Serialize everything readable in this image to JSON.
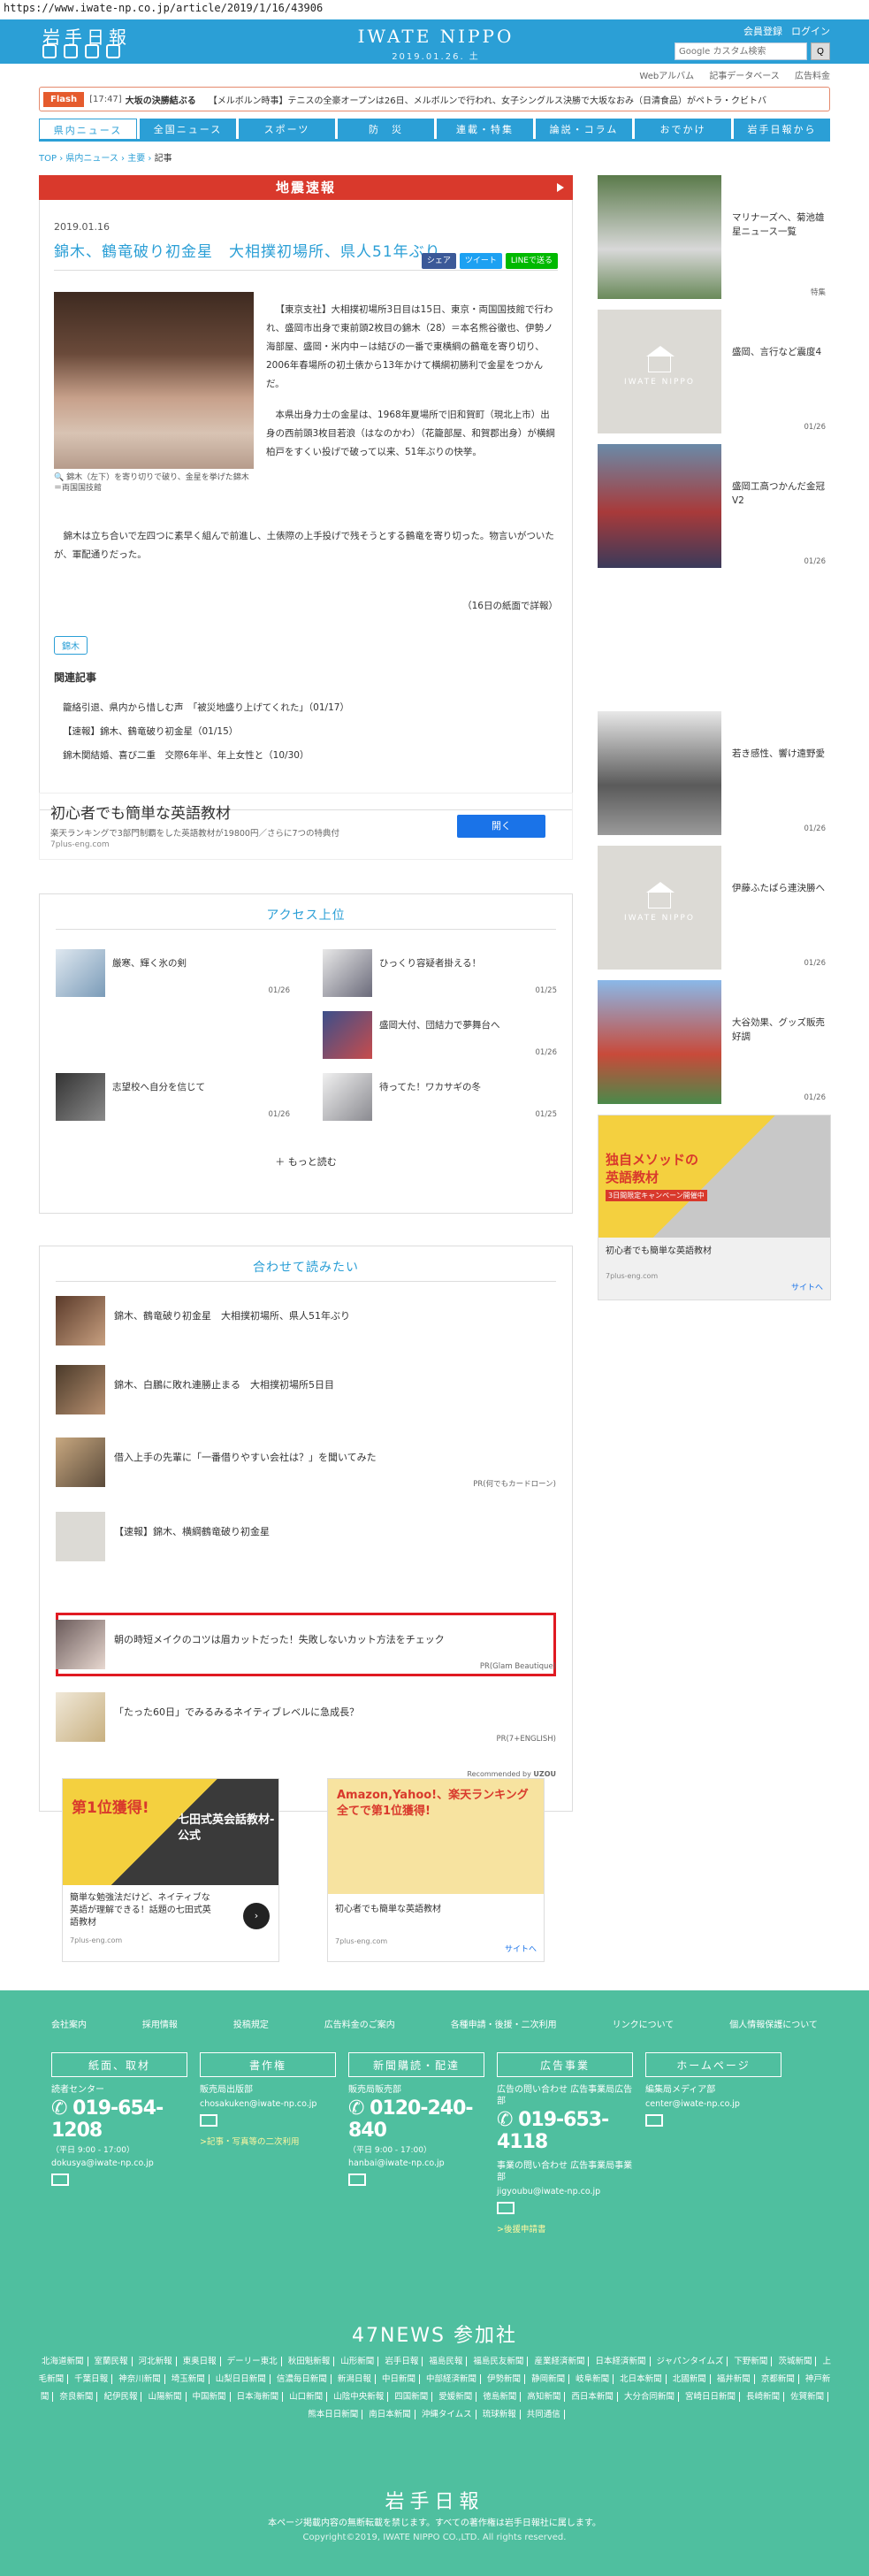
{
  "url": "https://www.iwate-np.co.jp/article/2019/1/16/43906",
  "header": {
    "logo": "岩手日報",
    "brand": "IWATE NIPPO",
    "date": "2019.01.26. 土",
    "member": "会員登録",
    "login": "ログイン",
    "search_placeholder": "Google カスタム検索",
    "search_btn": "Q"
  },
  "sublinks": [
    "Webアルバム",
    "記事データベース",
    "広告料金"
  ],
  "flash": {
    "tag": "Flash",
    "time": "[17:47]",
    "headline": "大坂の決勝結ぶる",
    "text": "【メルボルン時事】テニスの全豪オープンは26日、メルボルンで行われ、女子シングルス決勝で大坂なおみ（日清食品）がペトラ・クビトバ"
  },
  "nav": [
    "県内ニュース",
    "全国ニュース",
    "スポーツ",
    "防　災",
    "連載・特集",
    "論説・コラム",
    "おでかけ",
    "岩手日報から"
  ],
  "breadcrumb": [
    "TOP",
    "県内ニュース",
    "主要",
    "記事"
  ],
  "quake": "地震速報",
  "article": {
    "date": "2019.01.16",
    "share": [
      "シェア",
      "ツイート",
      "LINEで送る"
    ],
    "title": "錦木、鶴竜破り初金星　大相撲初場所、県人51年ぶり",
    "caption": "錦木（左下）を寄り切りで破り、金星を挙げた錦木＝両国国技館",
    "p1": "【東京支社】大相撲初場所3日目は15日、東京・両国国技館で行われ、盛岡市出身で東前頭2枚目の錦木（28）＝本名熊谷徹也、伊勢ノ海部屋、盛岡・米内中－は結びの一番で東横綱の鶴竜を寄り切り、2006年春場所の初土俵から13年かけて横綱初勝利で金星をつかんだ。",
    "p2": "本県出身力士の金星は、1968年夏場所で旧和賀町（現北上市）出身の西前頭3枚目若浪（はなのかわ）（花籠部屋、和賀郡出身）が横綱柏戸をすくい投げで破って以来、51年ぶりの快挙。",
    "p3": "錦木は立ち合いで左四つに素早く組んで前進し、土俵際の上手投げで残そうとする鶴竜を寄り切った。物言いがついたが、軍配通りだった。",
    "note": "（16日の紙面で詳報）",
    "tag": "錦木",
    "related_head": "関連記事",
    "related": [
      "籠絡引退、県内から惜しむ声　「被災地盛り上げてくれた」（01/17）",
      "【速報】錦木、鶴竜破り初金星（01/15）",
      "錦木関結婚、喜び二重　交際6年半、年上女性と（10/30）"
    ]
  },
  "ad1": {
    "title": "初心者でも簡単な英語教材",
    "text": "楽天ランキングで3部門制覇をした英語教材が19800円／さらに7つの特典付",
    "domain": "7plus-eng.com",
    "button": "開く"
  },
  "ranking": {
    "head": "アクセス上位",
    "items": [
      {
        "title": "厳寒、輝く氷の剣",
        "date": "01/26"
      },
      {
        "title": "ひっくり容疑者掛える！",
        "date": "01/25"
      },
      {
        "title": "盛岡大付、団結力で夢舞台へ",
        "date": "01/26"
      },
      {
        "title": "志望校へ自分を信じて",
        "date": "01/26"
      },
      {
        "title": "待ってた！ワカサギの冬",
        "date": "01/25"
      }
    ],
    "more": "もっと読む"
  },
  "recommend": {
    "head": "合わせて読みたい",
    "items": [
      {
        "title": "錦木、鶴竜破り初金星　大相撲初場所、県人51年ぶり",
        "pr": ""
      },
      {
        "title": "錦木、白鵬に敗れ連勝止まる　大相撲初場所5日目",
        "pr": ""
      },
      {
        "title": "借入上手の先輩に「一番借りやすい会社は？」を聞いてみた",
        "pr": "PR(何でもカードローン)"
      },
      {
        "title": "【速報】錦木、横綱鶴竜破り初金星",
        "pr": ""
      },
      {
        "title": "朝の時短メイクのコツは眉カットだった！失敗しないカット方法をチェック",
        "pr": "PR(Glam Beautique)"
      },
      {
        "title": "「たった60日」でみるみるネイティブレベルに急成長？",
        "pr": "PR(7+ENGLISH)"
      }
    ],
    "by": "Recommended by",
    "uzou": "UZOU"
  },
  "ad2": {
    "badge1": "第1位獲得!",
    "title1": "七田式英会話教材-公式",
    "text1": "簡単な勉強法だけど、ネイティブな英語が理解できる！話題の七田式英語教材",
    "domain1": "7plus-eng.com",
    "badge2": "Amazon,Yahoo!、楽天ランキング全てで第1位獲得!",
    "text2": "初心者でも簡単な英語教材",
    "domain2": "7plus-eng.com",
    "site": "サイトへ"
  },
  "side": [
    {
      "title": "マリナーズへ、菊池雄星ニュース一覧",
      "date": "特集"
    },
    {
      "title": "盛岡、言行など震度4",
      "date": "01/26"
    },
    {
      "title": "盛岡工高つかんだ金冠V2",
      "date": "01/26"
    },
    {
      "title": "若き感性、響け遠野愛",
      "date": "01/26"
    },
    {
      "title": "伊藤ふたばら連決勝へ",
      "date": "01/26"
    },
    {
      "title": "大谷効果、グッズ販売好調",
      "date": "01/26"
    }
  ],
  "side_ad": {
    "badge": "独自メソッドの英語教材",
    "sub": "3日間限定キャンペーン開催中",
    "text": "初心者でも簡単な英語教材",
    "domain": "7plus-eng.com",
    "site": "サイトへ"
  },
  "footer": {
    "links": [
      "会社案内",
      "採用情報",
      "投稿規定",
      "広告料金のご案内",
      "各種申請・後援・二次利用",
      "リンクについて",
      "個人情報保護について"
    ],
    "cols": [
      {
        "head": "紙面、取材",
        "label": "読者センター",
        "tel": "019-654-1208",
        "hours": "（平日 9:00 - 17:00）",
        "mail": "dokusya@iwate-np.co.jp",
        "extra": ""
      },
      {
        "head": "書作権",
        "label": "販売局出版部",
        "tel": "",
        "hours": "",
        "mail": "chosakuken@iwate-np.co.jp",
        "extra": ">記事・写真等の二次利用"
      },
      {
        "head": "新聞購読・配達",
        "label": "販売局販売部",
        "tel": "0120-240-840",
        "hours": "（平日 9:00 - 17:00）",
        "mail": "hanbai@iwate-np.co.jp",
        "extra": ""
      },
      {
        "head": "広告事業",
        "label": "広告の問い合わせ 広告事業局広告部",
        "tel": "019-653-4118",
        "hours": "",
        "mail": "jigyoubu@iwate-np.co.jp",
        "extra": ">後援申請書",
        "label2": "事業の問い合わせ 広告事業局事業部"
      },
      {
        "head": "ホームページ",
        "label": "編集局メディア部",
        "tel": "",
        "hours": "",
        "mail": "center@iwate-np.co.jp",
        "extra": ""
      }
    ],
    "news47": "47NEWS 参加社",
    "papers": [
      "北海道新聞",
      "室蘭民報",
      "河北新報",
      "東奥日報",
      "デーリー東北",
      "秋田魁新報",
      "山形新聞",
      "岩手日報",
      "福島民報",
      "福島民友新聞",
      "産業経済新聞",
      "日本経済新聞",
      "ジャパンタイムズ",
      "下野新聞",
      "茨城新聞",
      "上毛新聞",
      "千葉日報",
      "神奈川新聞",
      "埼玉新聞",
      "山梨日日新聞",
      "信濃毎日新聞",
      "新潟日報",
      "中日新聞",
      "中部経済新聞",
      "伊勢新聞",
      "静岡新聞",
      "岐阜新聞",
      "北日本新聞",
      "北國新聞",
      "福井新聞",
      "京都新聞",
      "神戸新聞",
      "奈良新聞",
      "紀伊民報",
      "山陽新聞",
      "中国新聞",
      "日本海新聞",
      "山口新聞",
      "山陰中央新報",
      "四国新聞",
      "愛媛新聞",
      "徳島新聞",
      "高知新聞",
      "西日本新聞",
      "大分合同新聞",
      "宮崎日日新聞",
      "長崎新聞",
      "佐賀新聞",
      "熊本日日新聞",
      "南日本新聞",
      "沖縄タイムス",
      "琉球新報",
      "共同通信"
    ],
    "logo": "岩手日報",
    "copy1": "本ページ掲載内容の無断転載を禁じます。すべての著作権は岩手日報社に属します。",
    "copy2": "Copyright©2019, IWATE NIPPO CO.,LTD. All rights reserved."
  }
}
